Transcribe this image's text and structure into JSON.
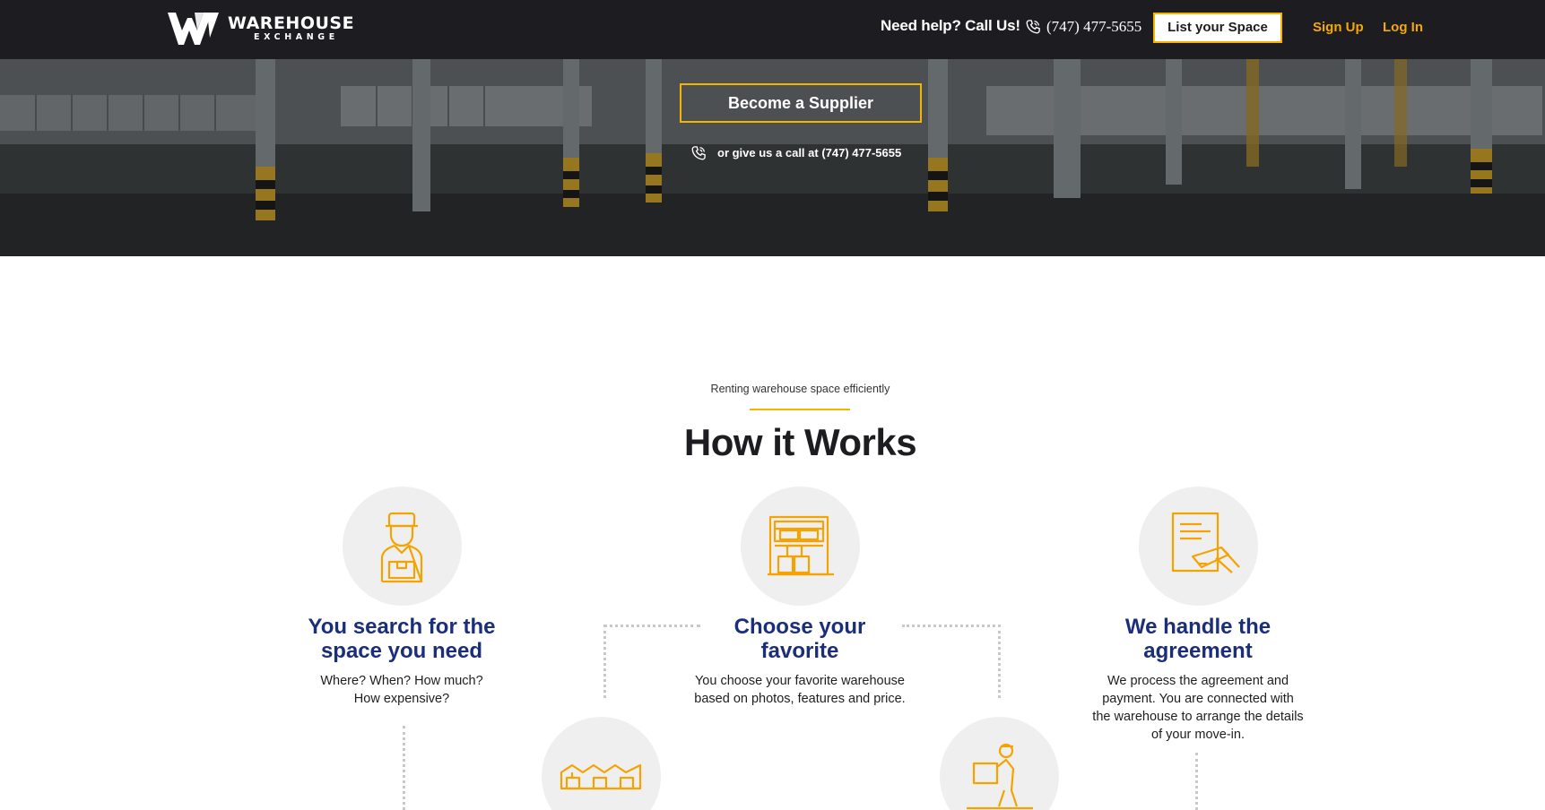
{
  "brand": {
    "name": "WAREHOUSE",
    "tagline": "EXCHANGE",
    "accent_color": "#f5b400",
    "heading_blue": "#1a2e7a",
    "nav_bg": "#1d1d21"
  },
  "nav": {
    "help_text": "Need help? Call Us!",
    "phone": "(747) 477-5655",
    "list_space_label": "List your Space",
    "signup_label": "Sign Up",
    "login_label": "Log In"
  },
  "hero": {
    "supplier_button_label": "Become a Supplier",
    "call_text": "or give us a call at (747) 477-5655"
  },
  "how_it_works": {
    "eyebrow": "Renting warehouse space efficiently",
    "title": "How it Works",
    "steps": [
      {
        "icon": "delivery-person-icon",
        "title_line1": "You search for the",
        "title_line2": "space you need",
        "text_line1": "Where? When? How much?",
        "text_line2": "How expensive?"
      },
      {
        "icon": "warehouse-storage-icon",
        "title_line1": "Choose your",
        "title_line2": "favorite",
        "text_line1": "You choose your favorite warehouse",
        "text_line2": "based on photos, features and price."
      },
      {
        "icon": "signing-agreement-icon",
        "title_line1": "We handle the",
        "title_line2": "agreement",
        "text_line1": "We process the agreement and",
        "text_line2": "payment. You are connected with",
        "text_line3": "the warehouse to arrange the details",
        "text_line4": "of your move-in."
      }
    ],
    "lower_icons": [
      "warehouse-row-icon",
      "worker-carrying-box-icon"
    ]
  }
}
